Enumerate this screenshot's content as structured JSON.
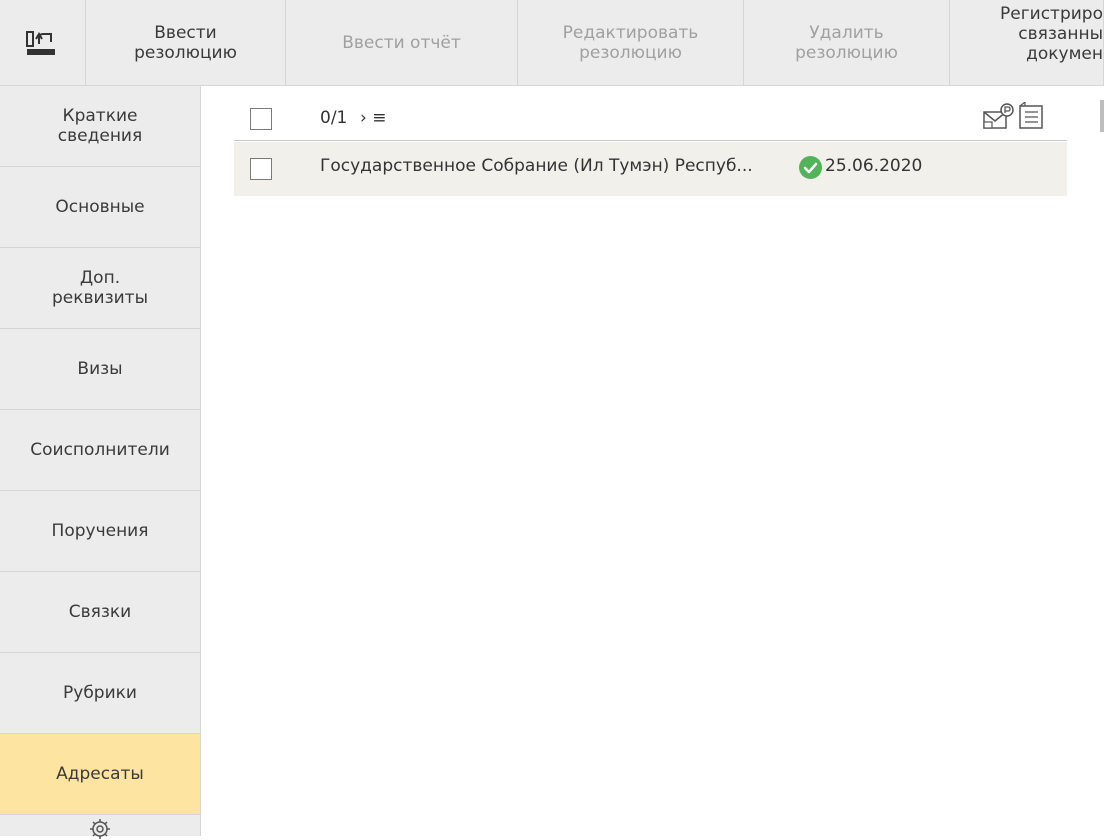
{
  "toolbar": {
    "buttons": [
      {
        "label": "Ввести\nрезолюцию",
        "enabled": true
      },
      {
        "label": "Ввести отчёт",
        "enabled": false
      },
      {
        "label": "Редактировать\nрезолюцию",
        "enabled": false
      },
      {
        "label": "Удалить\nрезолюцию",
        "enabled": false
      },
      {
        "label": "Регистриро\nсвязанны\nдокумен",
        "enabled": true
      }
    ]
  },
  "sidebar": {
    "items": [
      {
        "label": "Краткие\nсведения"
      },
      {
        "label": "Основные"
      },
      {
        "label": "Доп.\nреквизиты"
      },
      {
        "label": "Визы"
      },
      {
        "label": "Соисполнители"
      },
      {
        "label": "Поручения"
      },
      {
        "label": "Связки"
      },
      {
        "label": "Рубрики"
      },
      {
        "label": "Адресаты",
        "active": true
      }
    ]
  },
  "list": {
    "counter": "0/1",
    "sort_symbol": "› ≡",
    "rows": [
      {
        "title": "Государственное Собрание (Ил Тумэн) Респуб...",
        "date": "25.06.2020",
        "status": "approved"
      }
    ]
  },
  "colors": {
    "toolbar_bg": "#ececec",
    "active_item": "#fde5a1",
    "row_bg": "#f2f0eb",
    "status_ok": "#52b45a"
  }
}
